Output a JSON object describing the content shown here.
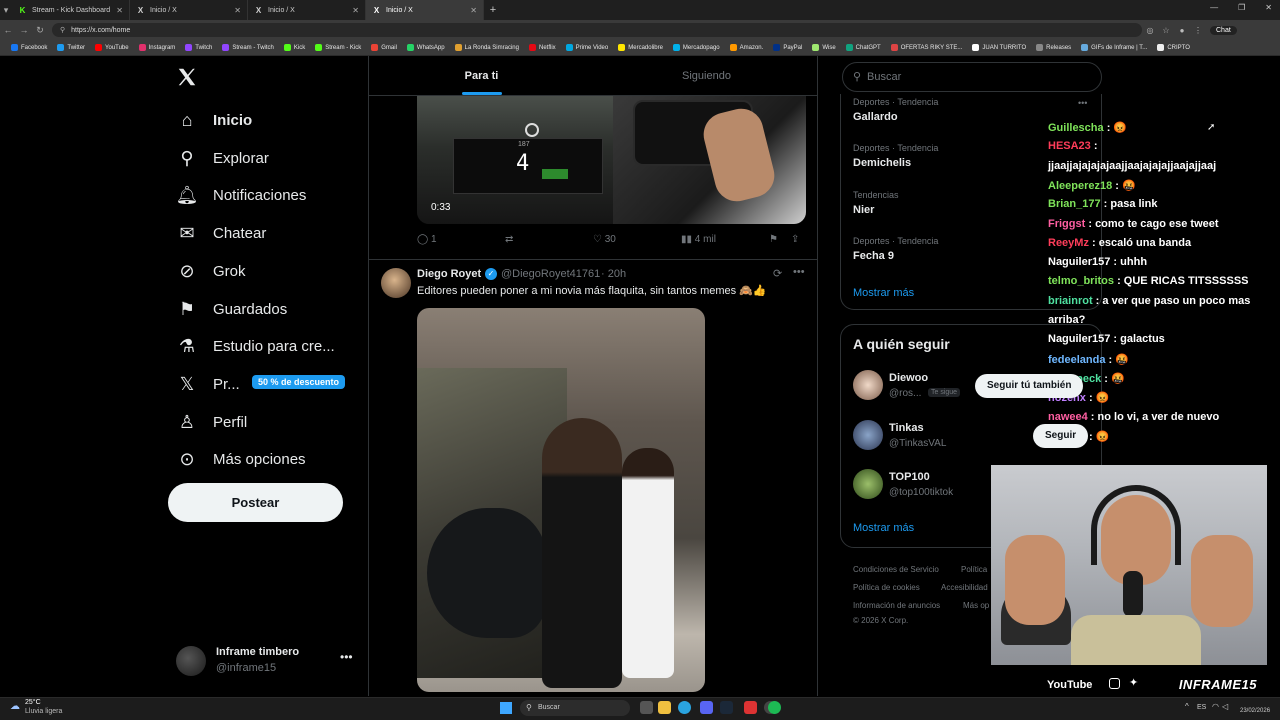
{
  "browser": {
    "tabs": [
      {
        "title": "Stream - Kick Dashboard",
        "favicon": "K",
        "color": "#53fc18"
      },
      {
        "title": "Inicio / X",
        "favicon": "X",
        "color": "#ffffff"
      },
      {
        "title": "Inicio / X",
        "favicon": "X",
        "color": "#ffffff"
      },
      {
        "title": "Inicio / X",
        "favicon": "X",
        "color": "#ffffff"
      }
    ],
    "url": "https://x.com/home",
    "chat_button": "Chat",
    "bookmarks": [
      "Facebook",
      "Twitter",
      "YouTube",
      "Instagram",
      "Twitch",
      "Stream - Twitch",
      "Kick",
      "Stream - Kick",
      "Gmail",
      "WhatsApp",
      "La Ronda Simracing",
      "Netflix",
      "Prime Video",
      "Mercadolibre",
      "Mercadopago",
      "Amazon.",
      "PayPal",
      "Wise",
      "ChatGPT",
      "OFERTAS RIKY STE...",
      "JUAN TURRITO",
      "Releases",
      "GIFs de Inframe | T...",
      "CRIPTO"
    ]
  },
  "sidebar": {
    "items": [
      {
        "label": "Inicio",
        "icon": "home-icon"
      },
      {
        "label": "Explorar",
        "icon": "search-icon"
      },
      {
        "label": "Notificaciones",
        "icon": "bell-icon"
      },
      {
        "label": "Chatear",
        "icon": "mail-icon"
      },
      {
        "label": "Grok",
        "icon": "grok-icon"
      },
      {
        "label": "Guardados",
        "icon": "bookmark-icon"
      },
      {
        "label": "Estudio para cre...",
        "icon": "creator-studio-icon"
      },
      {
        "label": "Pr...",
        "icon": "x-premium-icon"
      },
      {
        "label": "Perfil",
        "icon": "person-icon"
      },
      {
        "label": "Más opciones",
        "icon": "more-circle-icon"
      }
    ],
    "premium_badge": "50 % de descuento",
    "post_button": "Postear",
    "account": {
      "name": "Inframe timbero",
      "handle": "@inframe15"
    }
  },
  "feed": {
    "tabs": [
      "Para ti",
      "Siguiendo"
    ],
    "video_time": "0:33",
    "game_hud": {
      "gear": "4",
      "speed": "187"
    },
    "tweet1_actions": {
      "replies": "1",
      "retweets": "",
      "likes": "30",
      "views": "4 mil"
    },
    "tweet2": {
      "author": "Diego Royet",
      "handle": "@DiegoRoyet41761",
      "time": "· 20h",
      "text": "Editores pueden poner a mi novia más flaquita, sin tantos memes 🙈👍"
    }
  },
  "right": {
    "search_placeholder": "Buscar",
    "trends": [
      {
        "context": "Deportes · Tendencia",
        "name": "Gallardo"
      },
      {
        "context": "Deportes · Tendencia",
        "name": "Demichelis"
      },
      {
        "context": "Tendencias",
        "name": "Nier"
      },
      {
        "context": "Deportes · Tendencia",
        "name": "Fecha 9"
      }
    ],
    "show_more": "Mostrar más",
    "who_to_follow_title": "A quién seguir",
    "who_to_follow": [
      {
        "name": "Diewoo",
        "handle": "@ros...",
        "badge": "Te sigue"
      },
      {
        "name": "Tinkas",
        "handle": "@TinkasVAL"
      },
      {
        "name": "TOP100",
        "handle": "@top100tiktok"
      }
    ],
    "follow_back_button": "Seguir tú también",
    "follow_button": "Seguir",
    "footer": [
      "Condiciones de Servicio",
      "Política",
      "Política de cookies",
      "Accesibilidad",
      "Información de anuncios",
      "Más op",
      "© 2026 X Corp."
    ]
  },
  "chat": [
    {
      "user": "Guilleschа",
      "color": "#7fe35a",
      "msg": "😡"
    },
    {
      "user": "HESA23",
      "color": "#ff3d5a",
      "msg": ""
    },
    {
      "user": "",
      "color": "#ffffff",
      "msg": "jjaajjajajajajaajjaajajajajjaajajjaaj"
    },
    {
      "user": "Aleeperez18",
      "color": "#7fe35a",
      "msg": "🤬"
    },
    {
      "user": "Brian_177",
      "color": "#7fe35a",
      "msg": "pasa link"
    },
    {
      "user": "Friggst",
      "color": "#ff5fa2",
      "msg": "como te cago ese tweet"
    },
    {
      "user": "ReeyMz",
      "color": "#ff3d5a",
      "msg": "escaló una banda"
    },
    {
      "user": "Naguiler157",
      "color": "#ffffff",
      "msg": "uhhh"
    },
    {
      "user": "telmo_britos",
      "color": "#7fe35a",
      "msg": "QUE RICAS TITSSSSSS"
    },
    {
      "user": "briainrot",
      "color": "#4fe0a0",
      "msg": "a ver que paso un poco mas"
    },
    {
      "user": "",
      "color": "#ffffff",
      "msg": "arriba?"
    },
    {
      "user": "Naguiler157",
      "color": "#ffffff",
      "msg": "galactus"
    },
    {
      "user": "fedeelanda",
      "color": "#6fb7ff",
      "msg": "🤬"
    },
    {
      "user": "Mosspeck",
      "color": "#4fe0a0",
      "msg": "🤬"
    },
    {
      "user": "hozenx",
      "color": "#c07fff",
      "msg": "😡"
    },
    {
      "user": "nawee4",
      "color": "#ff5fa2",
      "msg": "no lo vi, a ver de nuevo"
    },
    {
      "user": "hozenx",
      "color": "#c07fff",
      "msg": "😡"
    }
  ],
  "webcam": {
    "youtube": "YouTube",
    "brand": "INFRAME15"
  },
  "taskbar": {
    "weather_temp": "25°C",
    "weather_desc": "Lluvia ligera",
    "search": "Buscar",
    "lang": "ES",
    "date": "23/02/2026"
  }
}
